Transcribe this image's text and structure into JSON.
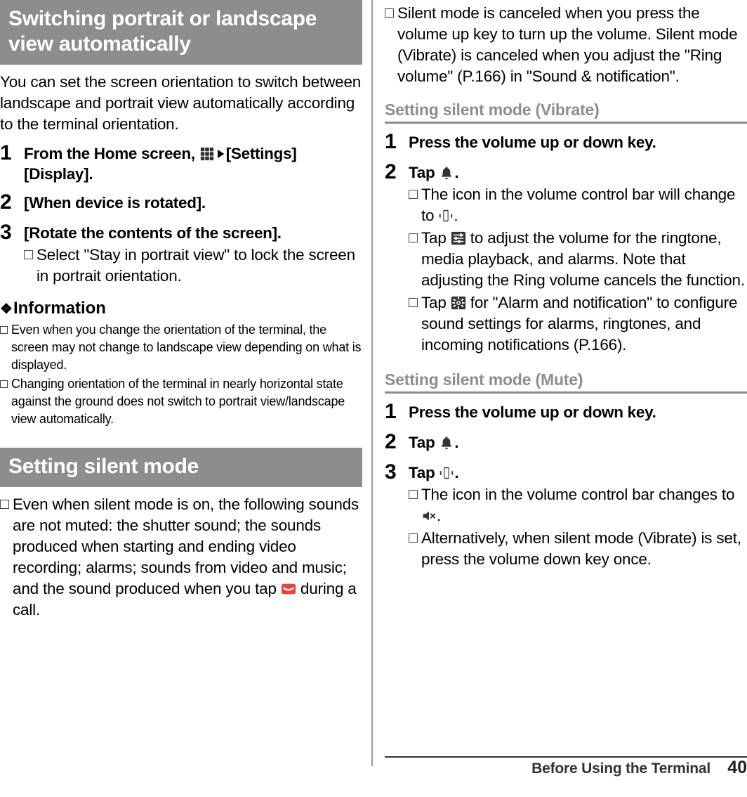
{
  "left": {
    "heading1": "Switching portrait or landscape view automatically",
    "intro": "You can set the screen orientation to switch between landscape and portrait view automatically according to the terminal orientation.",
    "steps": [
      {
        "num": "1",
        "title_pre": "From the Home screen, ",
        "title_post": "[Settings][Display]."
      },
      {
        "num": "2",
        "title": "[When device is rotated]."
      },
      {
        "num": "3",
        "title": "[Rotate the contents of the screen].",
        "note": "Select \"Stay in portrait view\" to lock the screen in portrait orientation."
      }
    ],
    "info_heading": "Information",
    "info_items": [
      "Even when you change the orientation of the terminal, the screen may not change to landscape view depending on what is displayed.",
      "Changing orientation of the terminal in nearly horizontal state against the ground does not switch to portrait view/landscape view automatically."
    ],
    "heading2": "Setting silent mode",
    "silent_note_a": "Even when silent mode is on, the following sounds are not muted: the shutter sound; the sounds produced when starting and ending video recording; alarms; sounds from video and music; and the sound produced when you tap ",
    "silent_note_b": " during a call."
  },
  "right": {
    "top_note_a": "Silent mode is canceled when you press the volume up key to turn up the volume. Silent mode (Vibrate) is canceled when you adjust the \"Ring volume\" (P.166) in \"Sound & notification\".",
    "subhead_vibrate": "Setting silent mode (Vibrate)",
    "vibrate_steps": [
      {
        "num": "1",
        "title": "Press the volume up or down key."
      },
      {
        "num": "2",
        "title_pre": "Tap ",
        "title_post": "."
      }
    ],
    "vibrate_notes": [
      {
        "pre": "The icon in the volume control bar will change to ",
        "post": "."
      },
      {
        "pre": "Tap ",
        "post": " to adjust the volume for the ringtone, media playback, and alarms. Note that adjusting the Ring volume cancels the function."
      },
      {
        "pre": "Tap ",
        "post": " for \"Alarm and notification\" to configure sound settings for alarms, ringtones, and incoming notifications (P.166)."
      }
    ],
    "subhead_mute": "Setting silent mode (Mute)",
    "mute_steps": [
      {
        "num": "1",
        "title": "Press the volume up or down key."
      },
      {
        "num": "2",
        "title_pre": "Tap ",
        "title_post": "."
      },
      {
        "num": "3",
        "title_pre": "Tap ",
        "title_post": "."
      }
    ],
    "mute_notes": [
      {
        "pre": "The icon in the volume control bar changes to ",
        "post": "."
      },
      {
        "pre": "Alternatively, when silent mode (Vibrate) is set, press the volume down key once.",
        "post": ""
      }
    ]
  },
  "footer": {
    "title": "Before Using the Terminal",
    "page": "40"
  },
  "icons": {
    "apps": "apps-grid-icon",
    "arrow": "play-arrow-icon",
    "bell": "bell-icon",
    "vibrate": "vibrate-icon",
    "sliders": "volume-sliders-icon",
    "settings": "settings-gear-icon",
    "mute": "speaker-mute-icon",
    "hangup": "end-call-icon"
  },
  "colors": {
    "heading_bar_bg": "#8d8d8d",
    "heading_bar_text": "#ffffff",
    "subhead": "#8d8d8d",
    "call_icon": "#e8453c"
  }
}
